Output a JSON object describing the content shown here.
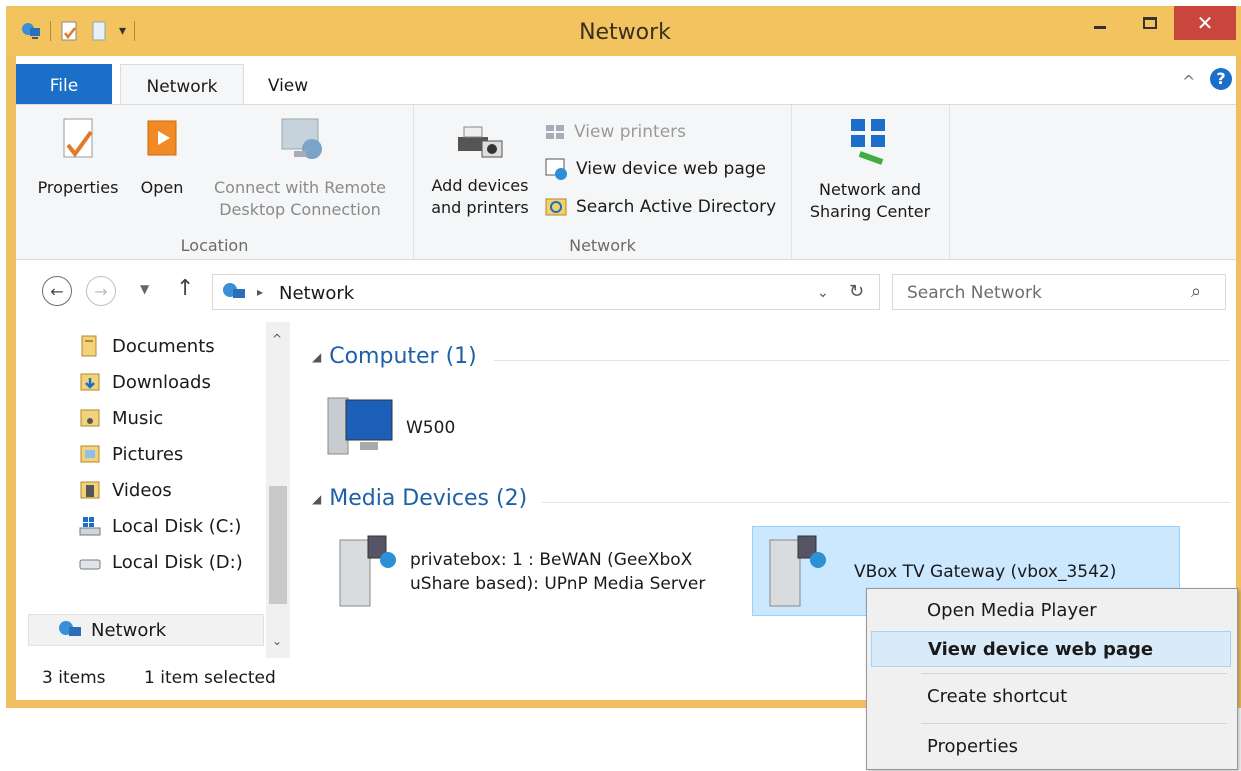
{
  "window": {
    "title": "Network",
    "close_label": "✕",
    "min_label": "—",
    "max_label": "☐"
  },
  "ribbon_tabs": {
    "file": "File",
    "network": "Network",
    "view": "View"
  },
  "ribbon": {
    "location_group": {
      "label": "Location",
      "properties": "Properties",
      "open": "Open",
      "connect_line1": "Connect with Remote",
      "connect_line2": "Desktop Connection"
    },
    "network_group": {
      "label": "Network",
      "add_line1": "Add devices",
      "add_line2": "and printers",
      "view_printers": "View printers",
      "view_device_web_page": "View device web page",
      "search_ad": "Search Active Directory"
    },
    "sharing": {
      "line1": "Network and",
      "line2": "Sharing Center"
    }
  },
  "address": {
    "location": "Network",
    "search_placeholder": "Search Network"
  },
  "nav_pane": {
    "items": [
      {
        "label": "Documents",
        "icon": "documents-folder-icon"
      },
      {
        "label": "Downloads",
        "icon": "downloads-folder-icon"
      },
      {
        "label": "Music",
        "icon": "music-folder-icon"
      },
      {
        "label": "Pictures",
        "icon": "pictures-folder-icon"
      },
      {
        "label": "Videos",
        "icon": "videos-folder-icon"
      },
      {
        "label": "Local Disk (C:)",
        "icon": "system-drive-icon"
      },
      {
        "label": "Local Disk (D:)",
        "icon": "drive-icon"
      }
    ],
    "network": "Network"
  },
  "content": {
    "computer_group": "Computer (1)",
    "computer_item": "W500",
    "media_group": "Media Devices (2)",
    "media_item1_line1": "privatebox: 1 : BeWAN (GeeXboX",
    "media_item1_line2": "uShare based): UPnP Media Server",
    "media_item2": "VBox TV Gateway (vbox_3542)"
  },
  "status": {
    "count": "3 items",
    "selected": "1 item selected"
  },
  "context_menu": {
    "items": [
      "Open Media Player",
      "View device web page",
      "Create shortcut",
      "Properties"
    ]
  },
  "colors": {
    "titlebar": "#f3c35f",
    "file_tab": "#1c6fc8",
    "close": "#c9463d",
    "group_header": "#1f5fa8",
    "selection": "#cce8ff"
  }
}
